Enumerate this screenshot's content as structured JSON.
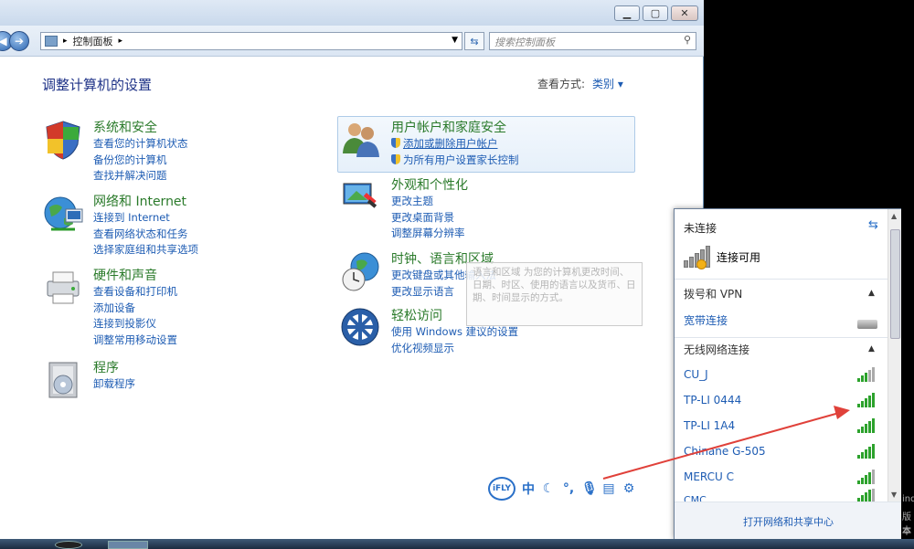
{
  "window": {
    "address_path": "控制面板",
    "search_placeholder": "搜索控制面板",
    "page_title": "调整计算机的设置",
    "view_by_label": "查看方式:",
    "view_by_value": "类别"
  },
  "categories": [
    {
      "title": "系统和安全",
      "links": [
        "查看您的计算机状态",
        "备份您的计算机",
        "查找并解决问题"
      ],
      "icon": "system-security-icon"
    },
    {
      "title": "网络和 Internet",
      "links": [
        "连接到 Internet",
        "查看网络状态和任务",
        "选择家庭组和共享选项"
      ],
      "icon": "network-internet-icon"
    },
    {
      "title": "硬件和声音",
      "links": [
        "查看设备和打印机",
        "添加设备",
        "连接到投影仪",
        "调整常用移动设置"
      ],
      "icon": "hardware-sound-icon"
    },
    {
      "title": "程序",
      "links": [
        "卸载程序"
      ],
      "icon": "programs-icon"
    },
    {
      "title": "用户帐户和家庭安全",
      "links": [
        "添加或删除用户帐户",
        "为所有用户设置家长控制"
      ],
      "icon": "user-accounts-icon"
    },
    {
      "title": "外观和个性化",
      "links": [
        "更改主题",
        "更改桌面背景",
        "调整屏幕分辨率"
      ],
      "icon": "appearance-icon"
    },
    {
      "title": "时钟、语言和区域",
      "links": [
        "更改键盘或其他输入法",
        "更改显示语言"
      ],
      "icon": "clock-language-icon"
    },
    {
      "title": "轻松访问",
      "links": [
        "使用 Windows 建议的设置",
        "优化视频显示"
      ],
      "icon": "ease-of-access-icon"
    }
  ],
  "tooltip": {
    "text": "语言和区域 为您的计算机更改时间、日期、时区、使用的语言以及货币、日期、时间显示的方式。"
  },
  "ime": {
    "logo": "iFLY",
    "mode": "中"
  },
  "network": {
    "status": "未连接",
    "available": "连接可用",
    "dialup_section": "拨号和 VPN",
    "broadband": "宽带连接",
    "wireless_section": "无线网络连接",
    "networks": [
      {
        "name": "CU_J",
        "signal": 3
      },
      {
        "name": "TP-LI 0444",
        "signal": 5
      },
      {
        "name": "TP-LI 1A4",
        "signal": 5
      },
      {
        "name": "Chinane G-505",
        "signal": 5
      },
      {
        "name": "MERCU C",
        "signal": 4
      },
      {
        "name": "CMC",
        "signal": 4
      }
    ],
    "footer_link": "打开网络和共享中心"
  },
  "colors": {
    "link": "#1e5cb3",
    "category_title": "#2a7a2a",
    "annotation_arrow": "#e0413a"
  }
}
